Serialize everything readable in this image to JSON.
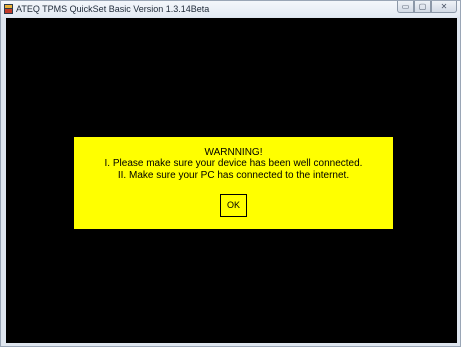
{
  "window": {
    "title": "ATEQ TPMS QuickSet Basic Version 1.3.14Beta",
    "minimize_glyph": "▭",
    "maximize_glyph": "▢",
    "close_glyph": "✕"
  },
  "dialog": {
    "title": "WARNNING!",
    "line1": "I. Please make sure your device has been well connected.",
    "line2": "II. Make sure your PC has connected to the internet.",
    "ok_label": "OK"
  },
  "colors": {
    "client_background": "#000000",
    "dialog_background": "#ffff00"
  }
}
